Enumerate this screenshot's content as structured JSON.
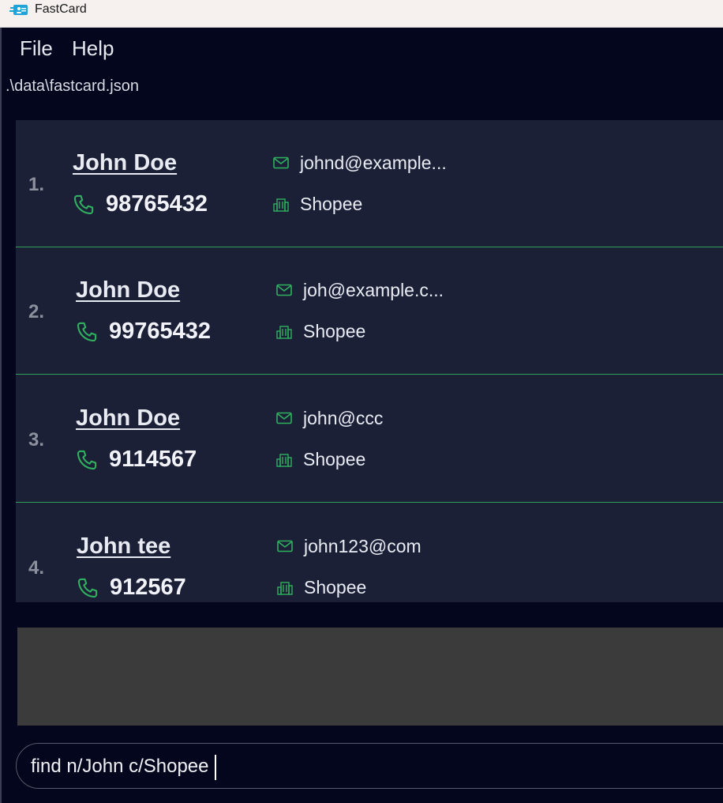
{
  "window": {
    "title": "FastCard"
  },
  "menu": {
    "items": [
      {
        "label": "File"
      },
      {
        "label": "Help"
      }
    ]
  },
  "status": {
    "file_path": ".\\data\\fastcard.json"
  },
  "contacts": [
    {
      "index": "1.",
      "name": "John Doe",
      "phone": "98765432",
      "email": "johnd@example...",
      "company": "Shopee"
    },
    {
      "index": "2.",
      "name": "John Doe",
      "phone": "99765432",
      "email": "joh@example.c...",
      "company": "Shopee"
    },
    {
      "index": "3.",
      "name": "John Doe",
      "phone": "9114567",
      "email": "john@ccc",
      "company": "Shopee"
    },
    {
      "index": "4.",
      "name": "John tee",
      "phone": "912567",
      "email": "john123@com",
      "company": "Shopee"
    }
  ],
  "result": {
    "text": ""
  },
  "command": {
    "value": "find n/John c/Shopee"
  },
  "icons": {
    "app": "fastcard-app-icon",
    "phone": "phone-icon",
    "email": "mail-icon",
    "company": "building-icon"
  },
  "colors": {
    "accent_green": "#2fb05f",
    "card_bg": "#1c2037",
    "window_bg": "#03061c",
    "result_bg": "#3b3b3b"
  }
}
